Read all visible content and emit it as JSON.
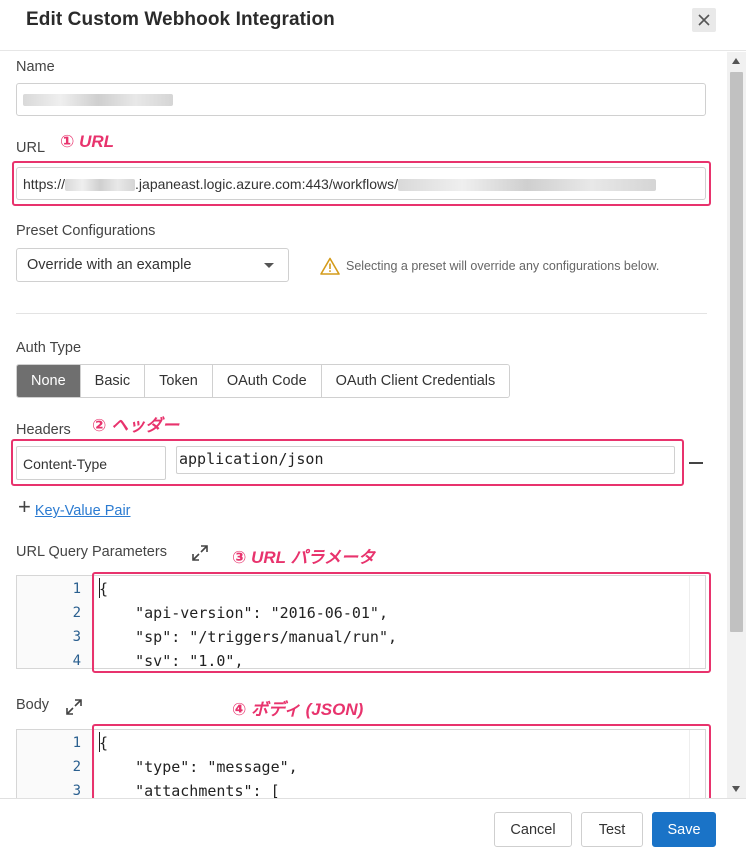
{
  "dialog": {
    "title": "Edit Custom Webhook Integration"
  },
  "form": {
    "name_label": "Name",
    "url_label": "URL",
    "url_prefix": "https://",
    "url_middle": ".japaneast.logic.azure.com:443/workflows/",
    "preset_label": "Preset Configurations",
    "preset_value": "Override with an example",
    "preset_warning": "Selecting a preset will override any configurations below.",
    "auth_label": "Auth Type",
    "auth_options": [
      "None",
      "Basic",
      "Token",
      "OAuth Code",
      "OAuth Client Credentials"
    ],
    "auth_selected": "None",
    "headers_label": "Headers",
    "header_key": "Content-Type",
    "header_value": "application/json",
    "add_pair_label": "Key-Value Pair",
    "query_label": "URL Query Parameters",
    "body_label": "Body"
  },
  "query_editor": {
    "line_numbers": [
      "1",
      "2",
      "3",
      "4"
    ],
    "lines": [
      "{",
      "    \"api-version\": \"2016-06-01\",",
      "    \"sp\": \"/triggers/manual/run\",",
      "    \"sv\": \"1.0\","
    ]
  },
  "body_editor": {
    "line_numbers": [
      "1",
      "2",
      "3"
    ],
    "lines": [
      "{",
      "    \"type\": \"message\",",
      "    \"attachments\": ["
    ]
  },
  "annotations": {
    "a1": "① URL",
    "a2": "② ヘッダー",
    "a3": "③ URL パラメータ",
    "a4": "④ ボディ (JSON)",
    "color": "#e8336d"
  },
  "footer": {
    "cancel": "Cancel",
    "test": "Test",
    "save": "Save"
  },
  "colors": {
    "primary": "#1a73c7",
    "segment_active": "#6f6f6f",
    "link": "#2b7bd1"
  }
}
